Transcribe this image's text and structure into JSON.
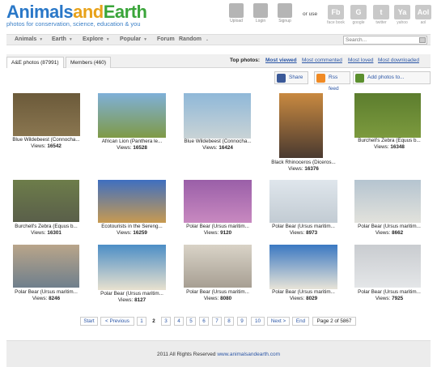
{
  "logo": {
    "part1": "Animals",
    "part2": "and",
    "part3": "Earth",
    "tagline": "photos for conservation, science, education & you"
  },
  "header_actions": [
    {
      "label": "Upload",
      "icon": "upload-icon"
    },
    {
      "label": "Login",
      "icon": "login-icon"
    },
    {
      "label": "Signup",
      "icon": "signup-icon"
    }
  ],
  "or_use": "or use",
  "social": [
    {
      "glyph": "Fb",
      "label": "face book"
    },
    {
      "glyph": "G",
      "label": "google"
    },
    {
      "glyph": "t",
      "label": "twitter"
    },
    {
      "glyph": "Ya",
      "label": "yahoo"
    },
    {
      "glyph": "Aol",
      "label": "aol"
    }
  ],
  "nav": [
    {
      "label": "Animals",
      "dropdown": true
    },
    {
      "label": "Earth",
      "dropdown": true
    },
    {
      "label": "Explore",
      "dropdown": true
    },
    {
      "label": "Popular",
      "dropdown": true
    },
    {
      "label": "Forum",
      "dropdown": false
    },
    {
      "label": "Random",
      "dropdown": false
    }
  ],
  "nav_trailing": ".",
  "search": {
    "placeholder": "Search..."
  },
  "tabs": [
    {
      "label": "A&E photos (87991)",
      "active": true
    },
    {
      "label": "Members (460)",
      "active": false
    }
  ],
  "top_photos": {
    "label": "Top photos:",
    "links": [
      {
        "label": "Most viewed",
        "active": true
      },
      {
        "label": "Most commented",
        "active": false
      },
      {
        "label": "Most loved",
        "active": false
      },
      {
        "label": "Most downloaded",
        "active": false
      }
    ]
  },
  "actions": [
    {
      "label": "Share",
      "icon": "facebook-icon",
      "color": "#3b5998"
    },
    {
      "label": "Rss feed",
      "icon": "rss-icon",
      "color": "#f08a24"
    },
    {
      "label": "Add photos to...",
      "icon": "add-photos-icon",
      "color": "#5b8f2e"
    }
  ],
  "views_label": "Views:",
  "photos": [
    {
      "title": "Blue Wildebeest (Connocha...",
      "views": "16542",
      "colors": [
        "#6b5a3a",
        "#8a7650"
      ]
    },
    {
      "title": "African Lion (Panthera le...",
      "views": "16528",
      "colors": [
        "#7fb0d8",
        "#7f9a46"
      ]
    },
    {
      "title": "Blue Wildebeest (Connocha...",
      "views": "16424",
      "colors": [
        "#8fb8d8",
        "#c9d3d6"
      ]
    },
    {
      "title": "Black Rhinoceros (Diceros...",
      "views": "16376",
      "colors": [
        "#c98a40",
        "#4a3a30"
      ]
    },
    {
      "title": "Burchell's Zebra (Equus b...",
      "views": "16348",
      "colors": [
        "#5c7d2e",
        "#7c9a3e"
      ]
    },
    {
      "title": "Burchell's Zebra (Equus b...",
      "views": "16301",
      "colors": [
        "#6d7d4a",
        "#5a5f4a"
      ]
    },
    {
      "title": "Ecotourists in the Sereng...",
      "views": "16259",
      "colors": [
        "#3f6fc0",
        "#c89a50"
      ]
    },
    {
      "title": "Polar Bear (Ursus maritim...",
      "views": "9120",
      "colors": [
        "#9a5fa8",
        "#c889c0"
      ]
    },
    {
      "title": "Polar Bear (Ursus maritim...",
      "views": "8973",
      "colors": [
        "#dfe6ec",
        "#c2cbd3"
      ]
    },
    {
      "title": "Polar Bear (Ursus maritim...",
      "views": "8662",
      "colors": [
        "#b5c4d0",
        "#e2e2dc"
      ]
    },
    {
      "title": "Polar Bear (Ursus maritim...",
      "views": "8246",
      "colors": [
        "#b9a58a",
        "#6f7f8c"
      ]
    },
    {
      "title": "Polar Bear (Ursus maritim...",
      "views": "8127",
      "colors": [
        "#4c8ec6",
        "#e8e1cf"
      ]
    },
    {
      "title": "Polar Bear (Ursus maritim...",
      "views": "8080",
      "colors": [
        "#d9d3c7",
        "#a79f93"
      ]
    },
    {
      "title": "Polar Bear (Ursus maritim...",
      "views": "8029",
      "colors": [
        "#3a78c2",
        "#e8e4d8"
      ]
    },
    {
      "title": "Polar Bear (Ursus maritim...",
      "views": "7925",
      "colors": [
        "#c9ccd0",
        "#e4e6e8"
      ]
    }
  ],
  "pagination": {
    "start": "Start",
    "previous": "< Previous",
    "pages": [
      "1",
      "2",
      "3",
      "4",
      "5",
      "6",
      "7",
      "8",
      "9",
      "10"
    ],
    "current": "2",
    "next": "Next >",
    "end": "End",
    "info": "Page 2 of 5867"
  },
  "footer": {
    "text": "2011 All Rights Reserved",
    "link": "www.animalsandearth.com"
  }
}
